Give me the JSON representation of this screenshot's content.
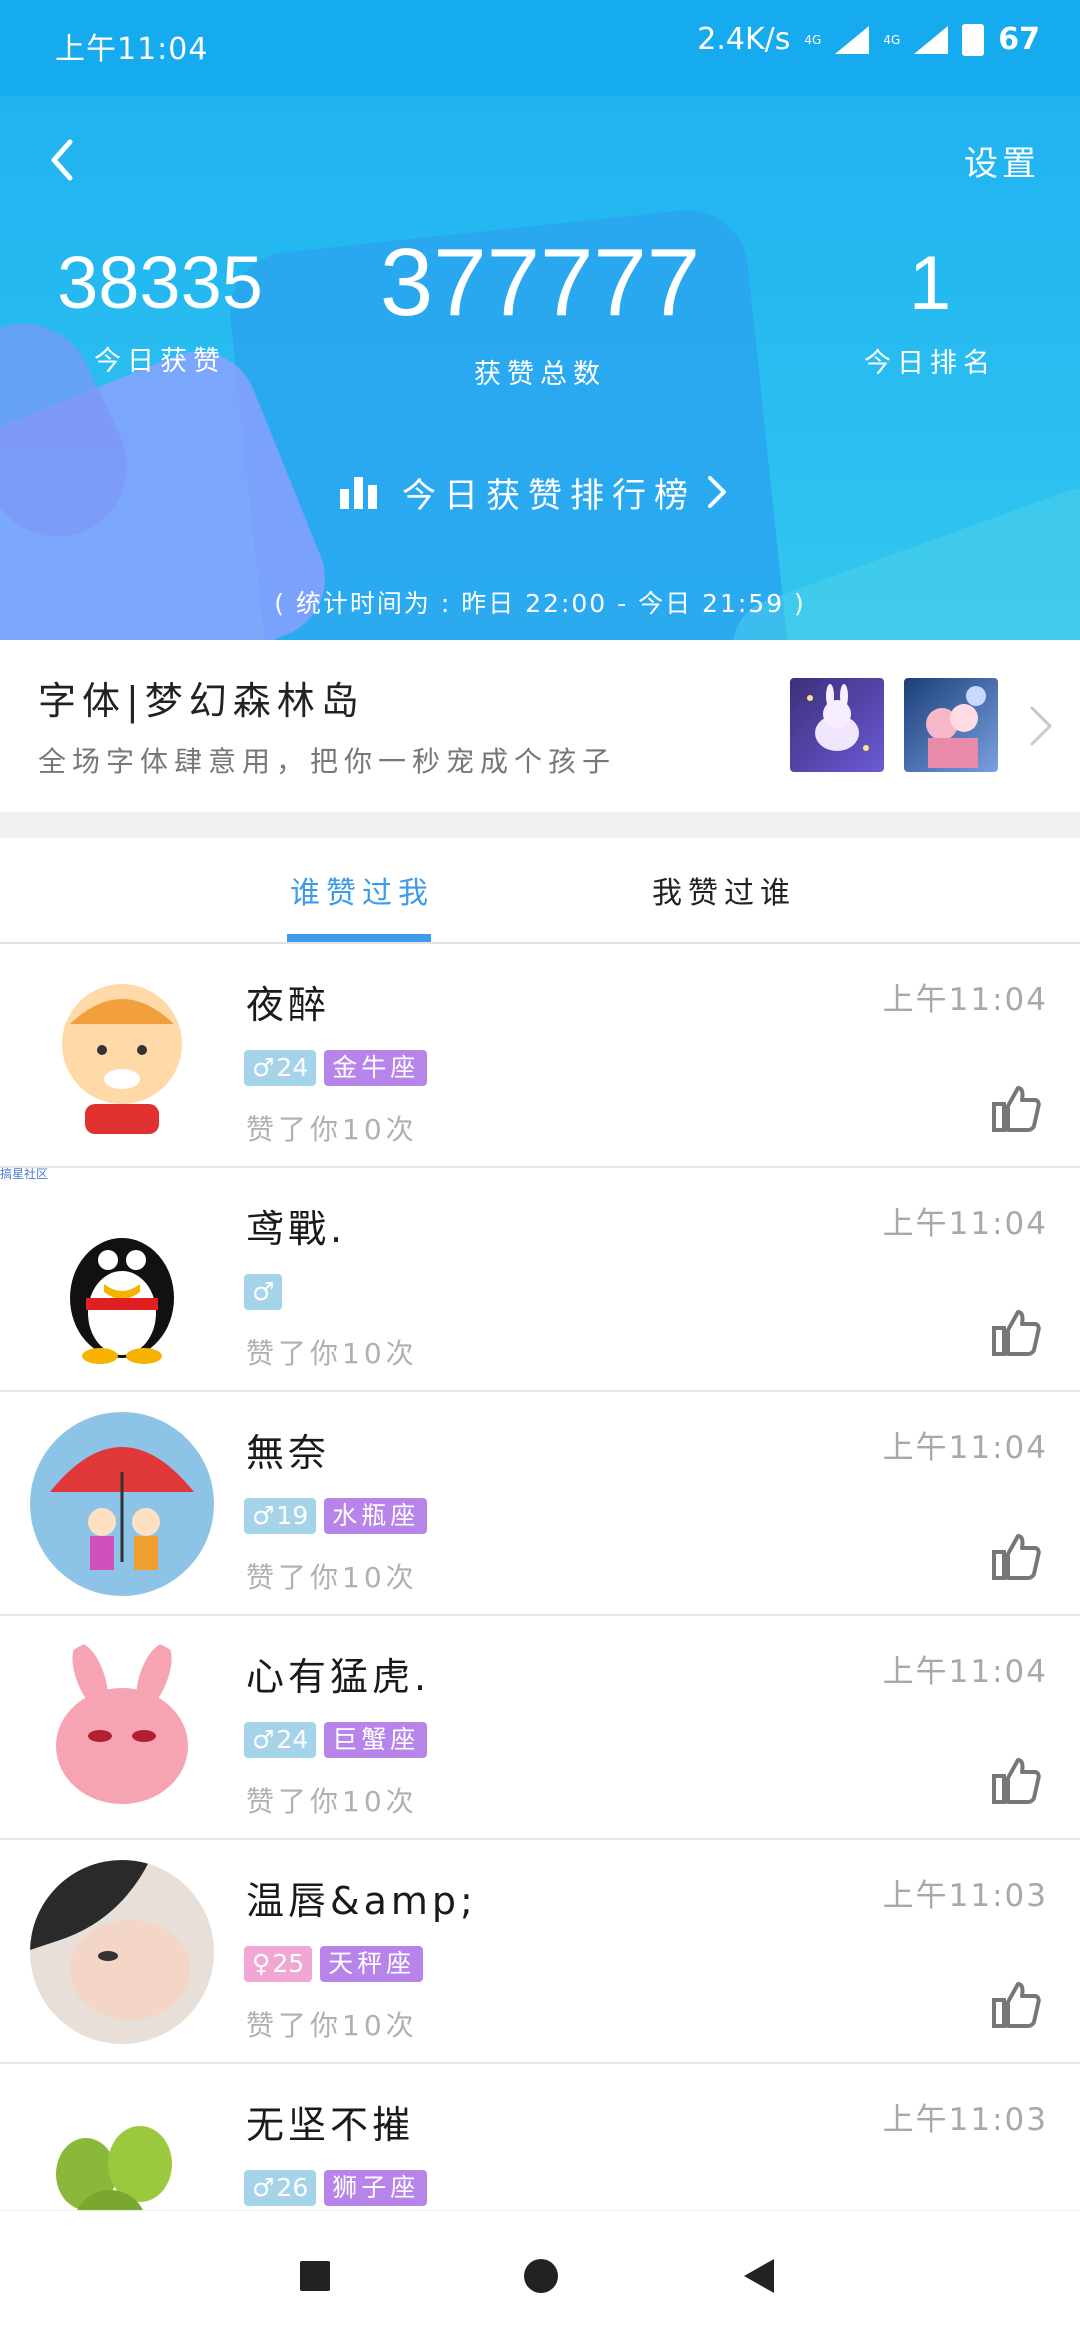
{
  "status_bar": {
    "time": "上午11:04",
    "speed": "2.4K/s",
    "net1": "4G",
    "net2": "4G",
    "battery": "67"
  },
  "header": {
    "settings_label": "设置",
    "stats": [
      {
        "value": "38335",
        "label": "今日获赞"
      },
      {
        "value": "377777",
        "label": "获赞总数"
      },
      {
        "value": "1",
        "label": "今日排名"
      }
    ],
    "ranking_link": "今日获赞排行榜",
    "stat_time": "( 统计时间为 : 昨日 22:00 - 今日 21:59 )"
  },
  "banner": {
    "title": "字体|梦幻森林岛",
    "subtitle": "全场字体肆意用，把你一秒宠成个孩子"
  },
  "tabs": [
    {
      "label": "谁赞过我",
      "active": true
    },
    {
      "label": "我赞过谁",
      "active": false
    }
  ],
  "watermark": "搞星社区",
  "list": [
    {
      "name": "夜醉",
      "gender": "♂",
      "age": "24",
      "zodiac": "金牛座",
      "time": "上午11:04",
      "note": "赞了你10次"
    },
    {
      "name": "鸢戰.",
      "gender": "♂",
      "age": "",
      "zodiac": "",
      "time": "上午11:04",
      "note": "赞了你10次"
    },
    {
      "name": "無奈",
      "gender": "♂",
      "age": "19",
      "zodiac": "水瓶座",
      "time": "上午11:04",
      "note": "赞了你10次"
    },
    {
      "name": "心有猛虎.",
      "gender": "♂",
      "age": "24",
      "zodiac": "巨蟹座",
      "time": "上午11:04",
      "note": "赞了你10次"
    },
    {
      "name": "温唇&amp;",
      "gender": "♀",
      "age": "25",
      "zodiac": "天秤座",
      "time": "上午11:03",
      "note": "赞了你10次"
    },
    {
      "name": "无坚不摧",
      "gender": "♂",
      "age": "26",
      "zodiac": "狮子座",
      "time": "上午11:03",
      "note": ""
    }
  ],
  "colors": {
    "accent": "#3d9be9",
    "header": "#1fb0f0",
    "male": "#a5d3ea",
    "female": "#f0a7d3",
    "zodiac": "#b785ea"
  },
  "icons": [
    "back-chevron-icon",
    "bar-chart-icon",
    "chevron-right-icon",
    "thumbs-up-icon",
    "male-icon",
    "female-icon"
  ]
}
